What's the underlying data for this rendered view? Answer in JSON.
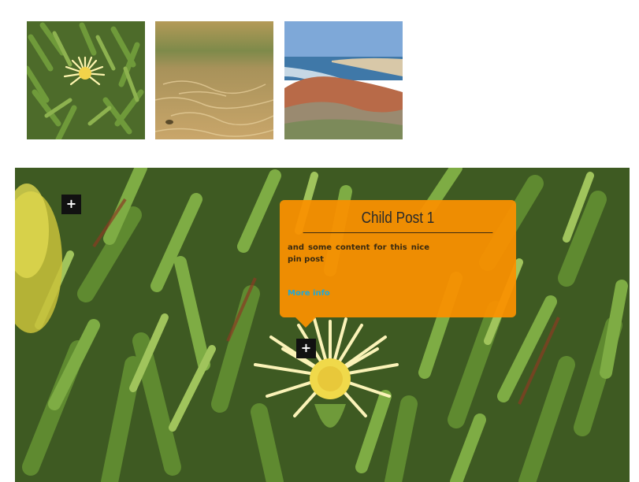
{
  "gallery": {
    "thumbnails": [
      {
        "icon": "flower-photo"
      },
      {
        "icon": "sand-water-photo"
      },
      {
        "icon": "coastline-photo"
      }
    ]
  },
  "pin_image": {
    "icon": "succulent-flower-photo",
    "markers": [
      {
        "symbol": "+"
      },
      {
        "symbol": "+"
      }
    ],
    "popup": {
      "title": "Child Post 1",
      "body": "and some content for this nice pin post",
      "link": "More info",
      "colors": {
        "background": "#fa9100",
        "link": "#1fa8d8"
      }
    }
  }
}
